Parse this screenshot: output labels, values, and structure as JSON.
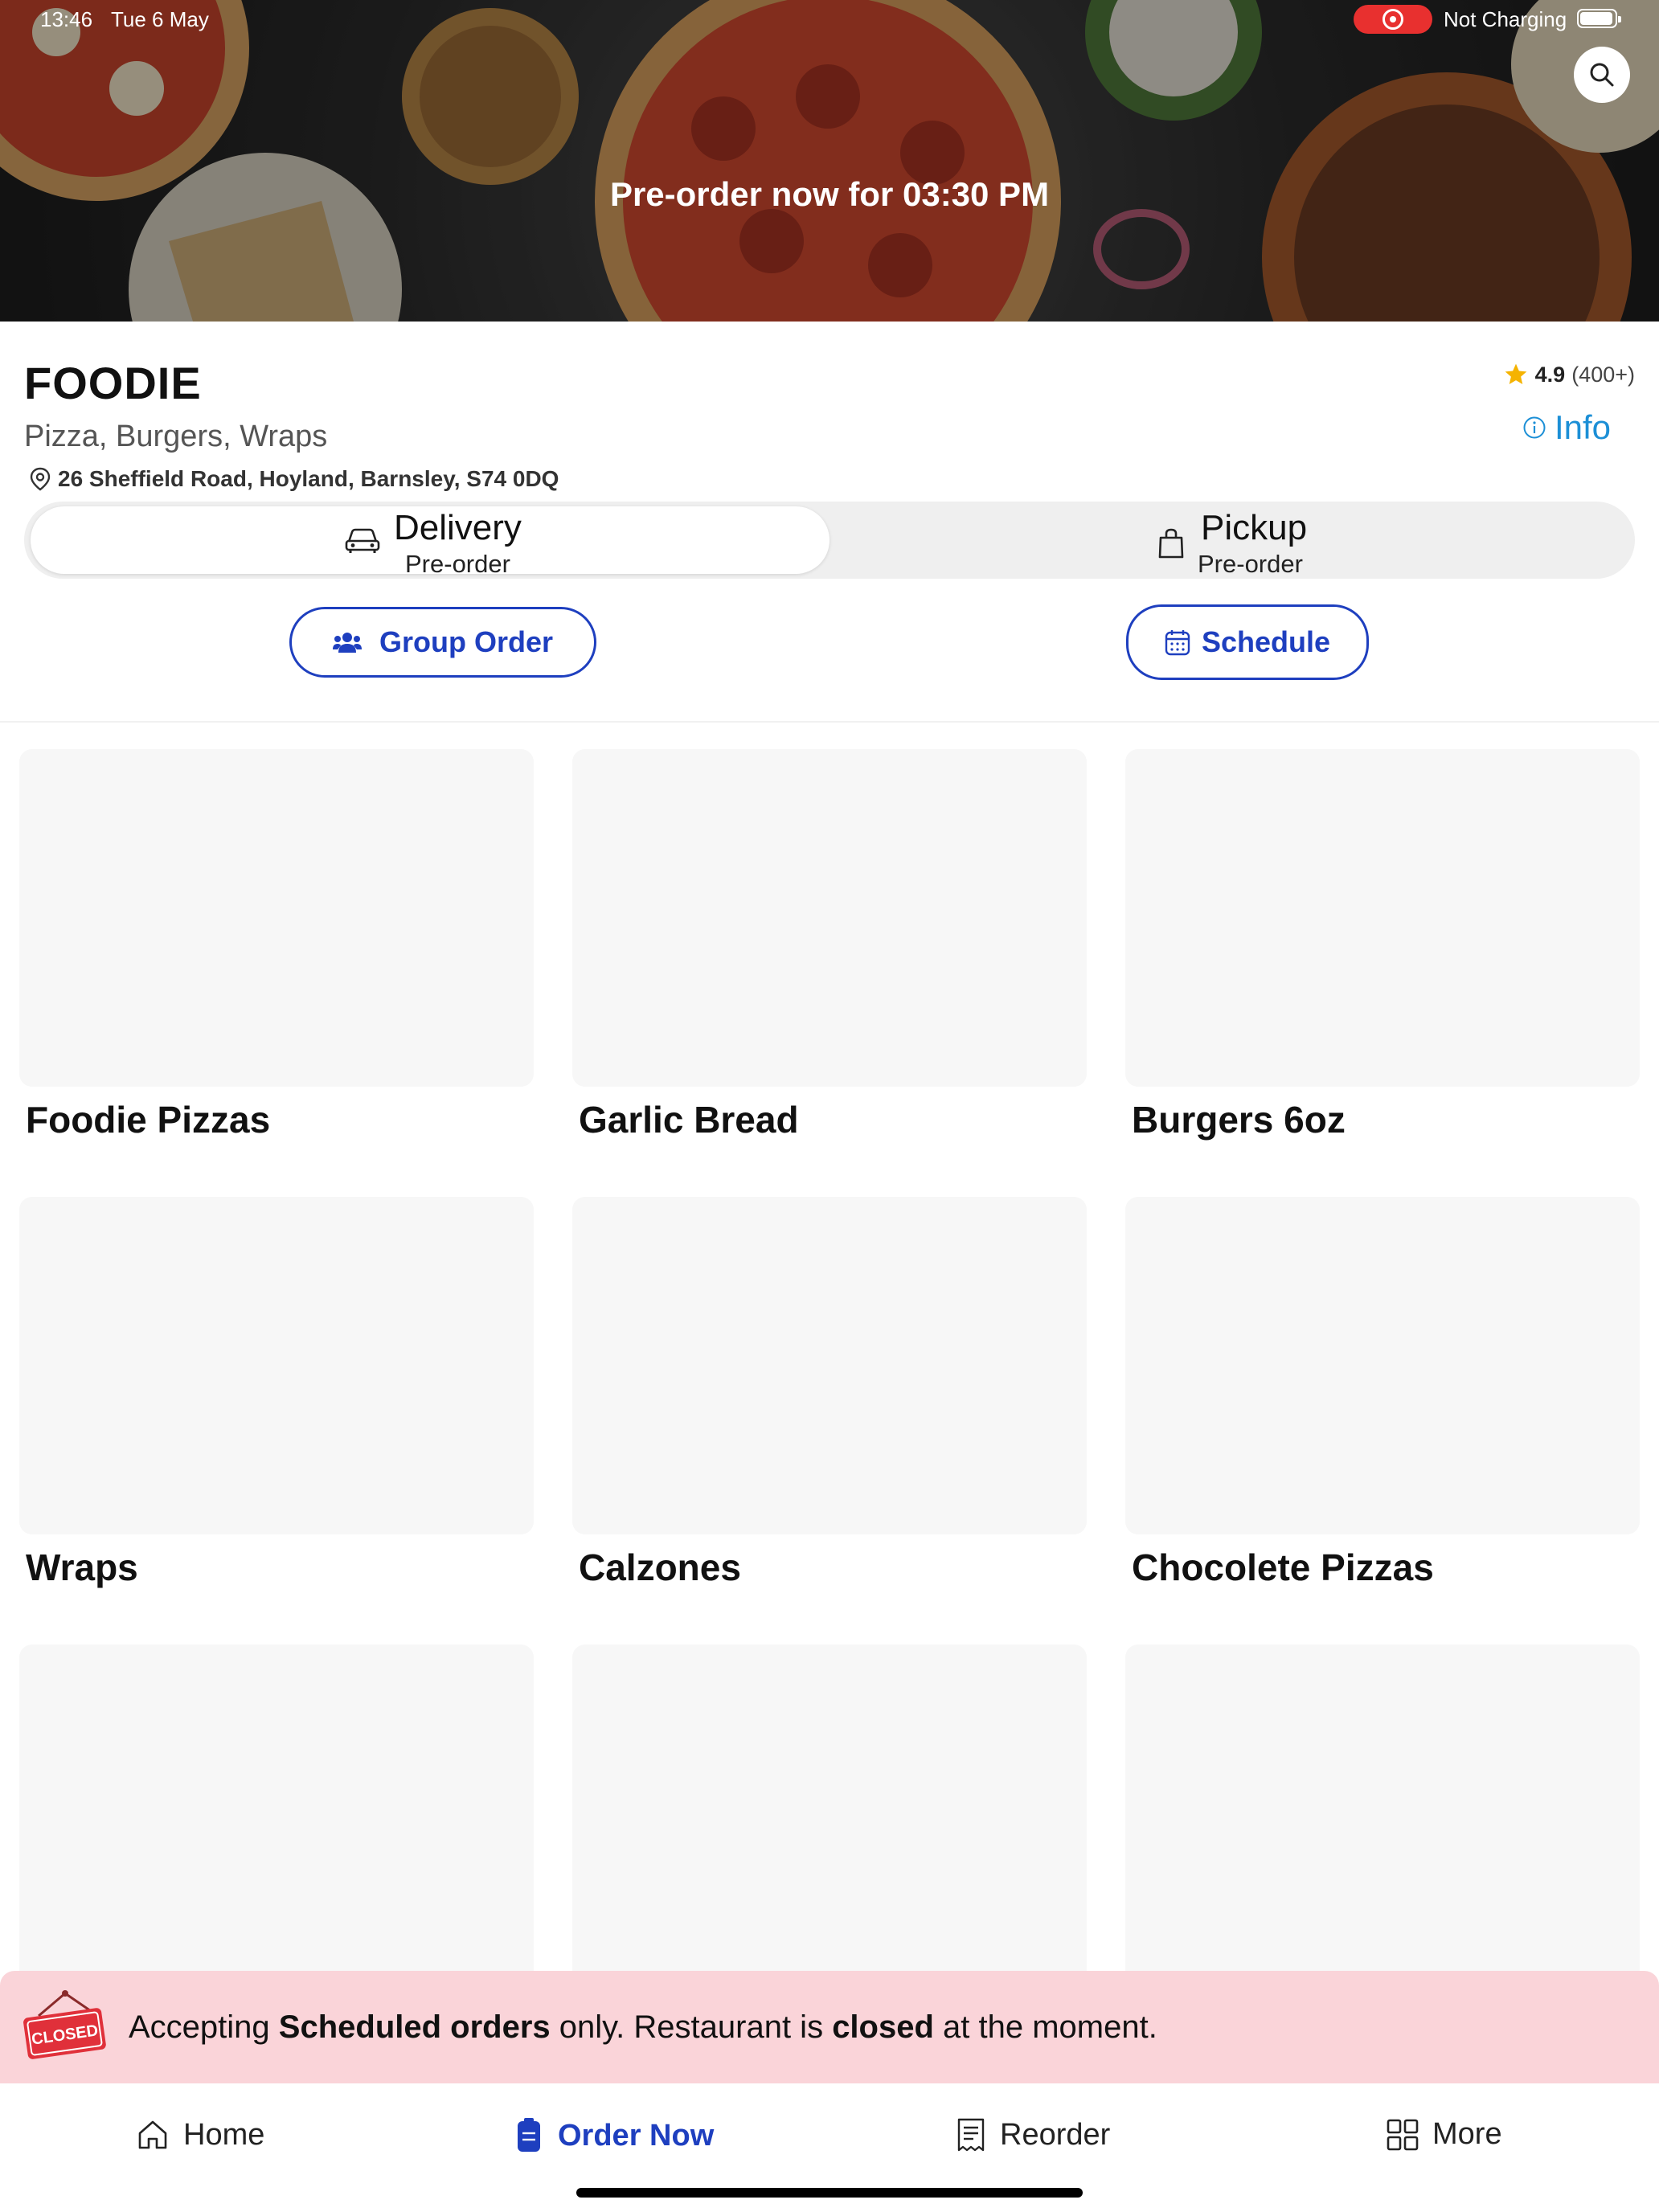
{
  "status_bar": {
    "time": "13:46",
    "date": "Tue 6 May",
    "charging": "Not Charging"
  },
  "hero": {
    "title": "Pre-order now for 03:30 PM",
    "search_icon": "search-icon"
  },
  "restaurant": {
    "name": "FOODIE",
    "cuisines": "Pizza, Burgers, Wraps",
    "address": "26 Sheffield Road, Hoyland, Barnsley, S74 0DQ",
    "rating": "4.9",
    "rating_count": "(400+)",
    "info_label": "Info"
  },
  "order_type": {
    "options": [
      {
        "title": "Delivery",
        "subtitle": "Pre-order",
        "icon": "car-icon",
        "selected": true
      },
      {
        "title": "Pickup",
        "subtitle": "Pre-order",
        "icon": "bag-icon",
        "selected": false
      }
    ]
  },
  "actions": {
    "group_order_label": "Group Order",
    "schedule_label": "Schedule"
  },
  "categories": [
    {
      "label": "Foodie Pizzas"
    },
    {
      "label": "Garlic Bread"
    },
    {
      "label": "Burgers 6oz"
    },
    {
      "label": "Wraps"
    },
    {
      "label": "Calzones"
    },
    {
      "label": "Chocolete Pizzas"
    },
    {
      "label": ""
    },
    {
      "label": ""
    },
    {
      "label": ""
    }
  ],
  "closed_banner": {
    "sign_text": "CLOSED",
    "part1": "Accepting ",
    "bold1": "Scheduled orders",
    "part2": " only. Restaurant is ",
    "bold2": "closed",
    "part3": " at the moment."
  },
  "bottom_nav": {
    "items": [
      {
        "label": "Home",
        "icon": "home-icon",
        "active": false
      },
      {
        "label": "Order Now",
        "icon": "order-icon",
        "active": true
      },
      {
        "label": "Reorder",
        "icon": "receipt-icon",
        "active": false
      },
      {
        "label": "More",
        "icon": "grid-icon",
        "active": false
      }
    ]
  },
  "colors": {
    "accent": "#1e3fbf",
    "info": "#1c8fd6",
    "star": "#f5b301",
    "banner_bg": "#fad4d9",
    "closed_sign": "#e0303a"
  }
}
